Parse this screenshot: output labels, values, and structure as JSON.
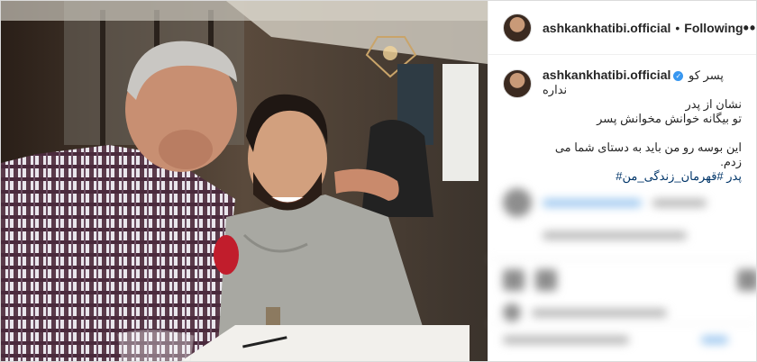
{
  "post": {
    "username": "ashkankhatibi.official",
    "separator": "•",
    "follow_status": "Following",
    "more_label": "•••",
    "verified_mark": "✓"
  },
  "caption": {
    "username": "ashkankhatibi.official",
    "lines": [
      "پسر کو نداره",
      "نشان از پدر",
      "تو بیگانه خوانش مخوانش پسر",
      "",
      "این بوسه رو من باید به دستای شما می زدم.",
      "پدر #قهرمان_زندگی_من#"
    ]
  },
  "icons": [
    "avatar",
    "verified-badge",
    "more-options-icon"
  ],
  "colors": {
    "verified": "#3897f0",
    "hashtag": "#003569",
    "text": "#262626"
  }
}
